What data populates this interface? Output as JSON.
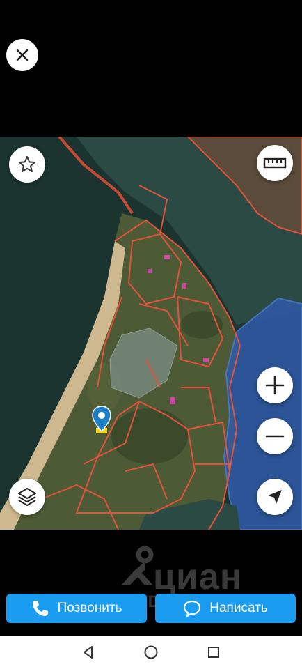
{
  "icons": {
    "close": "close-icon",
    "favorite": "star-icon",
    "ruler": "ruler-icon",
    "layers": "layers-icon",
    "zoom_in": "plus-icon",
    "zoom_out": "minus-icon",
    "locate": "navigation-arrow-icon",
    "pin": "map-pin-icon"
  },
  "watermark": {
    "brand": "циан",
    "id": "ID 325412719"
  },
  "actions": {
    "call_label": "Позвонить",
    "message_label": "Написать"
  },
  "colors": {
    "accent": "#1a9cf0",
    "parcel_outline": "#e2533c",
    "water_zone": "#2f5aa8"
  }
}
